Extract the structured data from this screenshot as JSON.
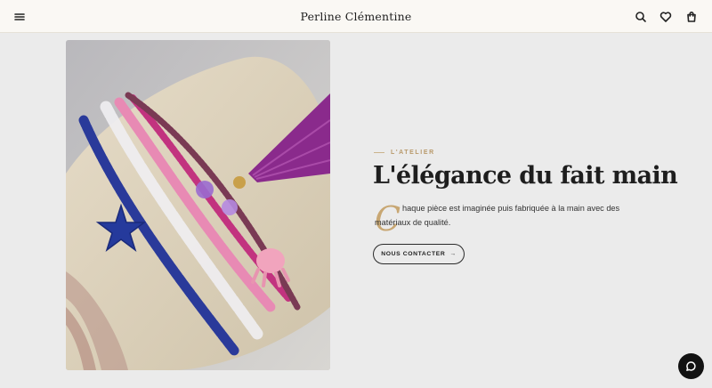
{
  "header": {
    "brand": "Perline Clémentine",
    "icons": [
      "menu-icon",
      "search-icon",
      "heart-icon",
      "shopping-bag-icon"
    ]
  },
  "hero": {
    "image_alt": "Bracelets de perles colorés avec pompon violet et breloques étoile de mer et poulpe",
    "eyebrow": "L'ATELIER",
    "headline": "L'élégance du fait main",
    "dropcap": "C",
    "body_line1": "haque pièce est imaginée puis fabriquée à la main avec des",
    "body_line2": "matériaux de qualité.",
    "cta_label": "NOUS CONTACTER",
    "cta_arrow": "→"
  },
  "chat": {
    "icon": "chat-bubble-icon"
  },
  "colors": {
    "accent_gold": "#c8a773",
    "header_bg": "#faf8f4",
    "page_bg": "#ebebeb",
    "text_dark": "#1e1e1e"
  }
}
